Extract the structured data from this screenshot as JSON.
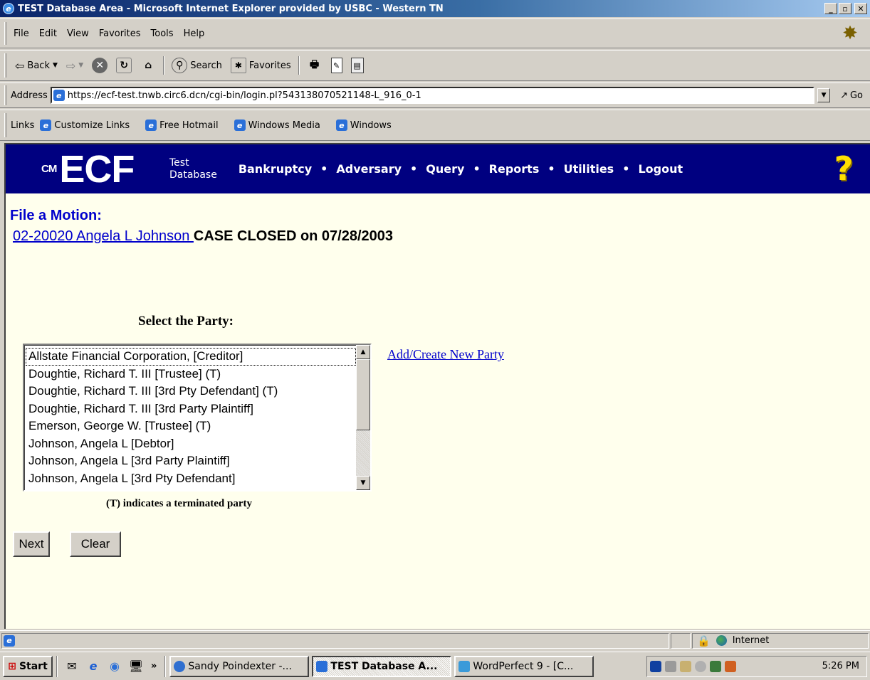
{
  "window": {
    "title": "TEST Database Area - Microsoft Internet Explorer provided by USBC - Western TN",
    "minimize": "_",
    "maximize": "▫",
    "close": "✕"
  },
  "menu": [
    "File",
    "Edit",
    "View",
    "Favorites",
    "Tools",
    "Help"
  ],
  "toolbar": {
    "back": "Back",
    "search": "Search",
    "favorites": "Favorites"
  },
  "address": {
    "label": "Address",
    "url": "https://ecf-test.tnwb.circ6.dcn/cgi-bin/login.pl?543138070521148-L_916_0-1",
    "go": "Go"
  },
  "links": {
    "label": "Links",
    "items": [
      "Customize Links",
      "Free Hotmail",
      "Windows Media",
      "Windows"
    ]
  },
  "banner": {
    "logo": "ECF",
    "logo_prefix": "CM",
    "db_line1": "Test",
    "db_line2": "Database",
    "nav": [
      "Bankruptcy",
      "Adversary",
      "Query",
      "Reports",
      "Utilities",
      "Logout"
    ],
    "help": "?"
  },
  "page": {
    "heading": "File a Motion:",
    "case_link": "02-20020 Angela L Johnson ",
    "case_status": "CASE CLOSED on 07/28/2003",
    "party_label": "Select the Party:",
    "parties": [
      "Allstate Financial Corporation, [Creditor]",
      "Doughtie, Richard T. III [Trustee] (T)",
      "Doughtie, Richard T. III [3rd Pty Defendant] (T)",
      "Doughtie, Richard T. III [3rd Party Plaintiff]",
      "Emerson, George W. [Trustee] (T)",
      "Johnson, Angela L [Debtor]",
      "Johnson, Angela L [3rd Party Plaintiff]",
      "Johnson, Angela L [3rd Pty Defendant]"
    ],
    "selected_party": "Allstate Financial Corporation, [Creditor]",
    "add_party": "Add/Create New Party",
    "terminated_note": "(T) indicates a terminated party",
    "next": "Next",
    "clear": "Clear"
  },
  "status": {
    "zone": "Internet"
  },
  "taskbar": {
    "start": "Start",
    "more": "»",
    "tasks": [
      "Sandy Poindexter -...",
      "TEST Database A...",
      "WordPerfect 9 - [C..."
    ],
    "active_task": "TEST Database A...",
    "clock": "5:26 PM"
  }
}
